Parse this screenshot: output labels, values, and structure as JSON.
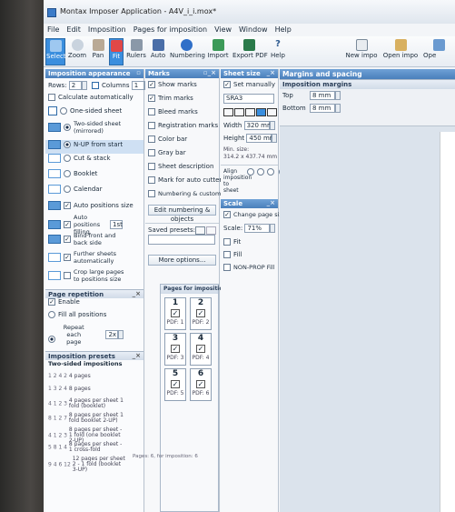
{
  "app": {
    "title": "Montax Imposer Application - A4V_i_i.mox*"
  },
  "menu": [
    "File",
    "Edit",
    "Imposition",
    "Pages for imposition",
    "View",
    "Window",
    "Help"
  ],
  "toolbar": [
    "Select",
    "Zoom",
    "Pan",
    "Fit",
    "Rulers",
    "Auto",
    "Numbering",
    "Import",
    "Export PDF",
    "Help"
  ],
  "toolbar_right": [
    "New impo",
    "Open impo",
    "Ope"
  ],
  "imposition_appearance": {
    "title": "Imposition appearance",
    "rows_label": "Rows:",
    "rows": "2",
    "columns_label": "Columns",
    "columns": "1",
    "calc_auto": "Calculate automatically",
    "sheet_options": [
      "One-sided sheet",
      "Two-sided sheet (mirrored)"
    ],
    "method_options": [
      "N-UP from start",
      "Cut & stack",
      "Booklet",
      "Calendar"
    ],
    "auto_positions_size": "Auto positions size",
    "auto_positions_filling": "Auto positions filling",
    "filling_value": "1st",
    "bind_front_back": "Bind front and back side",
    "further_sheets": "Further sheets automatically",
    "crop_large": "Crop large pages to positions size"
  },
  "page_repetition": {
    "title": "Page repetition",
    "enable": "Enable",
    "fill_all": "Fill all positions",
    "repeat": "Repeat",
    "each_page": "each page",
    "count": "2x"
  },
  "imposition_presets": {
    "title": "Imposition presets",
    "group": "Two-sided impositions",
    "items": [
      "4 pages",
      "8 pages",
      "4 pages per sheet 1 fold (booklet)",
      "8 pages per sheet 1 fold booklet 2-UP)",
      "8 pages per sheet - 1 fold (one booklet 2-UP)",
      "8 pages per sheet - 1 cross-fold",
      "12 pages per sheet 2 - 1 fold (booklet 3-UP)"
    ]
  },
  "marks": {
    "title": "Marks",
    "items": [
      {
        "label": "Show marks",
        "checked": true
      },
      {
        "label": "Trim marks",
        "checked": true
      },
      {
        "label": "Bleed marks",
        "checked": false
      },
      {
        "label": "Registration marks",
        "checked": false
      },
      {
        "label": "Color bar",
        "checked": false
      },
      {
        "label": "Gray bar",
        "checked": false
      },
      {
        "label": "Sheet description",
        "checked": false
      },
      {
        "label": "Mark for auto cutters",
        "checked": false
      },
      {
        "label": "Numbering & custom objects",
        "checked": false
      }
    ],
    "edit_btn": "Edit numbering & objects",
    "saved_presets": "Saved presets:",
    "more_options": "More options..."
  },
  "pages_for_imposition": {
    "title": "Pages for imposition",
    "pages": [
      {
        "num": "1",
        "label": "PDF: 1"
      },
      {
        "num": "2",
        "label": "PDF: 2"
      },
      {
        "num": "3",
        "label": "PDF: 3"
      },
      {
        "num": "4",
        "label": "PDF: 4"
      },
      {
        "num": "5",
        "label": "PDF: 5"
      },
      {
        "num": "6",
        "label": "PDF: 6"
      }
    ],
    "footer": "Pages: 6, for imposition: 6"
  },
  "sheet_size": {
    "title": "Sheet size",
    "set_manually": "Set manually",
    "format": "SRA3",
    "width_label": "Width",
    "width": "320 mm",
    "height_label": "Height",
    "height": "450 mm",
    "min_size_label": "Min. size:",
    "min_size": "314.2 x 437.74 mm",
    "align_label": "Align imposition to sheet"
  },
  "scale": {
    "title": "Scale",
    "change_page_size": "Change page size",
    "scale_label": "Scale:",
    "scale_value": "71%",
    "fit": "Fit",
    "fill": "Fill",
    "nonprop": "NON-PROP Fill"
  },
  "margins": {
    "title": "Margins and spacing",
    "subtitle": "Imposition margins",
    "top_label": "Top",
    "top": "8 mm",
    "bottom_label": "Bottom",
    "bottom": "8 mm"
  }
}
